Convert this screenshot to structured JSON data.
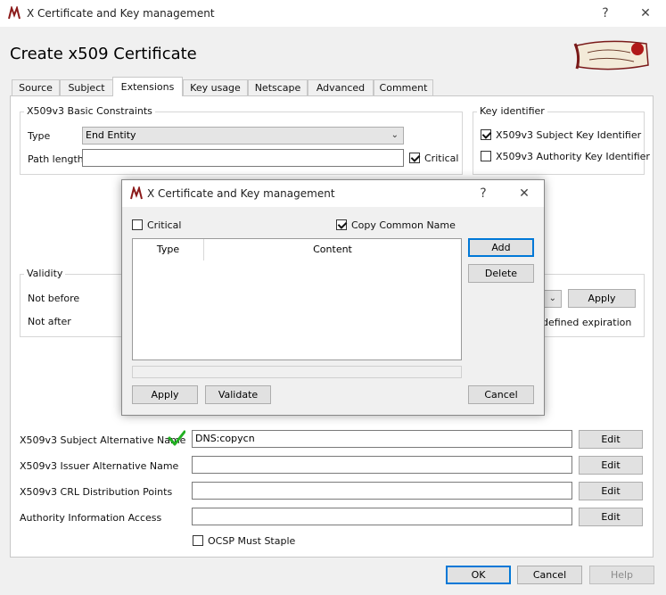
{
  "window": {
    "title": "X Certificate and Key management",
    "help": "?",
    "close": "✕"
  },
  "page_title": "Create x509 Certificate",
  "tabs": [
    "Source",
    "Subject",
    "Extensions",
    "Key usage",
    "Netscape",
    "Advanced",
    "Comment"
  ],
  "active_tab": "Extensions",
  "basic_constraints": {
    "title": "X509v3 Basic Constraints",
    "type_label": "Type",
    "type_value": "End Entity",
    "path_length_label": "Path length",
    "path_length_value": "",
    "critical_label": "Critical",
    "critical_checked": true
  },
  "key_identifier": {
    "title": "Key identifier",
    "subject_label": "X509v3 Subject Key Identifier",
    "subject_checked": true,
    "authority_label": "X509v3 Authority Key Identifier",
    "authority_checked": false
  },
  "validity": {
    "title": "Validity",
    "not_before_label": "Not before",
    "not_after_label": "Not after",
    "apply_label": "Apply",
    "expiration_fragment": "defined expiration"
  },
  "extensions": {
    "san_label": "X509v3 Subject Alternative Name",
    "san_value": "DNS:copycn",
    "ian_label": "X509v3 Issuer Alternative Name",
    "ian_value": "",
    "crl_label": "X509v3 CRL Distribution Points",
    "crl_value": "",
    "aia_label": "Authority Information Access",
    "aia_value": "",
    "edit_label": "Edit",
    "ocsp_label": "OCSP Must Staple",
    "ocsp_checked": false
  },
  "footer": {
    "ok": "OK",
    "cancel": "Cancel",
    "help": "Help"
  },
  "dialog": {
    "title": "X Certificate and Key management",
    "help": "?",
    "close": "✕",
    "critical_label": "Critical",
    "critical_checked": false,
    "copy_cn_label": "Copy Common Name",
    "copy_cn_checked": true,
    "columns": [
      "Type",
      "Content"
    ],
    "add": "Add",
    "delete": "Delete",
    "apply": "Apply",
    "validate": "Validate",
    "cancel": "Cancel"
  },
  "colors": {
    "accent": "#0078d7",
    "check_green": "#22b022"
  }
}
